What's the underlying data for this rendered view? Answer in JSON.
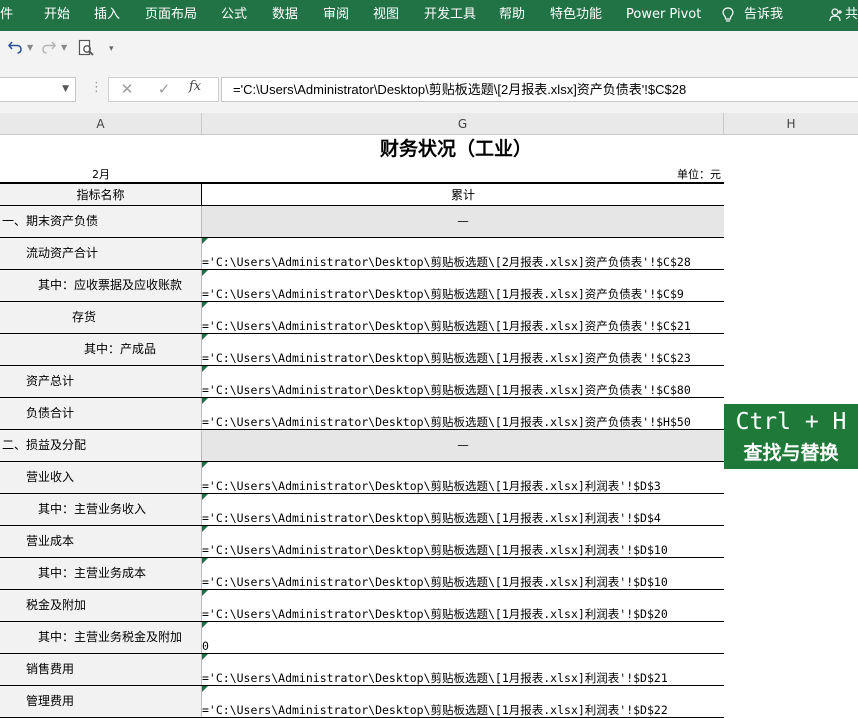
{
  "ribbon": {
    "tabs": [
      "件",
      "开始",
      "插入",
      "页面布局",
      "公式",
      "数据",
      "审阅",
      "视图",
      "开发工具",
      "帮助",
      "特色功能",
      "Power Pivot"
    ],
    "tell_me": "告诉我",
    "share": "共",
    "color": "#217346"
  },
  "quick_access": {
    "icons": [
      "undo-icon",
      "redo-icon",
      "print-preview-icon",
      "customize-toolbar-icon"
    ]
  },
  "formula_bar": {
    "name_box": "",
    "cancel_glyph": "✕",
    "enter_glyph": "✓",
    "fx_label": "fx",
    "formula": "='C:\\Users\\Administrator\\Desktop\\剪贴板选题\\[2月报表.xlsx]资产负债表'!$C$28"
  },
  "columns": [
    "A",
    "G",
    "H"
  ],
  "sheet": {
    "title": "财务状况（工业）",
    "month": "2月",
    "unit": "单位：元",
    "header_indicator": "指标名称",
    "header_value": "累计",
    "rows": [
      {
        "label": "一、期末资产负债",
        "value": "—",
        "section": true
      },
      {
        "label": "流动资产合计",
        "value": "='C:\\Users\\Administrator\\Desktop\\剪贴板选题\\[2月报表.xlsx]资产负债表'!$C$28"
      },
      {
        "label": "其中：应收票据及应收账款",
        "value": "='C:\\Users\\Administrator\\Desktop\\剪贴板选题\\[1月报表.xlsx]资产负债表'!$C$9"
      },
      {
        "label": "存货",
        "value": "='C:\\Users\\Administrator\\Desktop\\剪贴板选题\\[1月报表.xlsx]资产负债表'!$C$21"
      },
      {
        "label": "其中：产成品",
        "value": "='C:\\Users\\Administrator\\Desktop\\剪贴板选题\\[1月报表.xlsx]资产负债表'!$C$23"
      },
      {
        "label": "资产总计",
        "value": "='C:\\Users\\Administrator\\Desktop\\剪贴板选题\\[1月报表.xlsx]资产负债表'!$C$80"
      },
      {
        "label": "负债合计",
        "value": "='C:\\Users\\Administrator\\Desktop\\剪贴板选题\\[1月报表.xlsx]资产负债表'!$H$50"
      },
      {
        "label": "二、损益及分配",
        "value": "—",
        "section": true
      },
      {
        "label": "营业收入",
        "value": "='C:\\Users\\Administrator\\Desktop\\剪贴板选题\\[1月报表.xlsx]利润表'!$D$3"
      },
      {
        "label": "其中：主营业务收入",
        "value": "='C:\\Users\\Administrator\\Desktop\\剪贴板选题\\[1月报表.xlsx]利润表'!$D$4"
      },
      {
        "label": "营业成本",
        "value": "='C:\\Users\\Administrator\\Desktop\\剪贴板选题\\[1月报表.xlsx]利润表'!$D$10"
      },
      {
        "label": "其中：主营业务成本",
        "value": "='C:\\Users\\Administrator\\Desktop\\剪贴板选题\\[1月报表.xlsx]利润表'!$D$10"
      },
      {
        "label": "税金及附加",
        "value": "='C:\\Users\\Administrator\\Desktop\\剪贴板选题\\[1月报表.xlsx]利润表'!$D$20"
      },
      {
        "label": "其中：主营业务税金及附加",
        "value": "0"
      },
      {
        "label": "销售费用",
        "value": "='C:\\Users\\Administrator\\Desktop\\剪贴板选题\\[1月报表.xlsx]利润表'!$D$21"
      },
      {
        "label": "管理费用",
        "value": "='C:\\Users\\Administrator\\Desktop\\剪贴板选题\\[1月报表.xlsx]利润表'!$D$22"
      }
    ]
  },
  "overlay": {
    "title": "Ctrl + H",
    "subtitle": "查找与替换",
    "color": "#1f7a3a"
  }
}
